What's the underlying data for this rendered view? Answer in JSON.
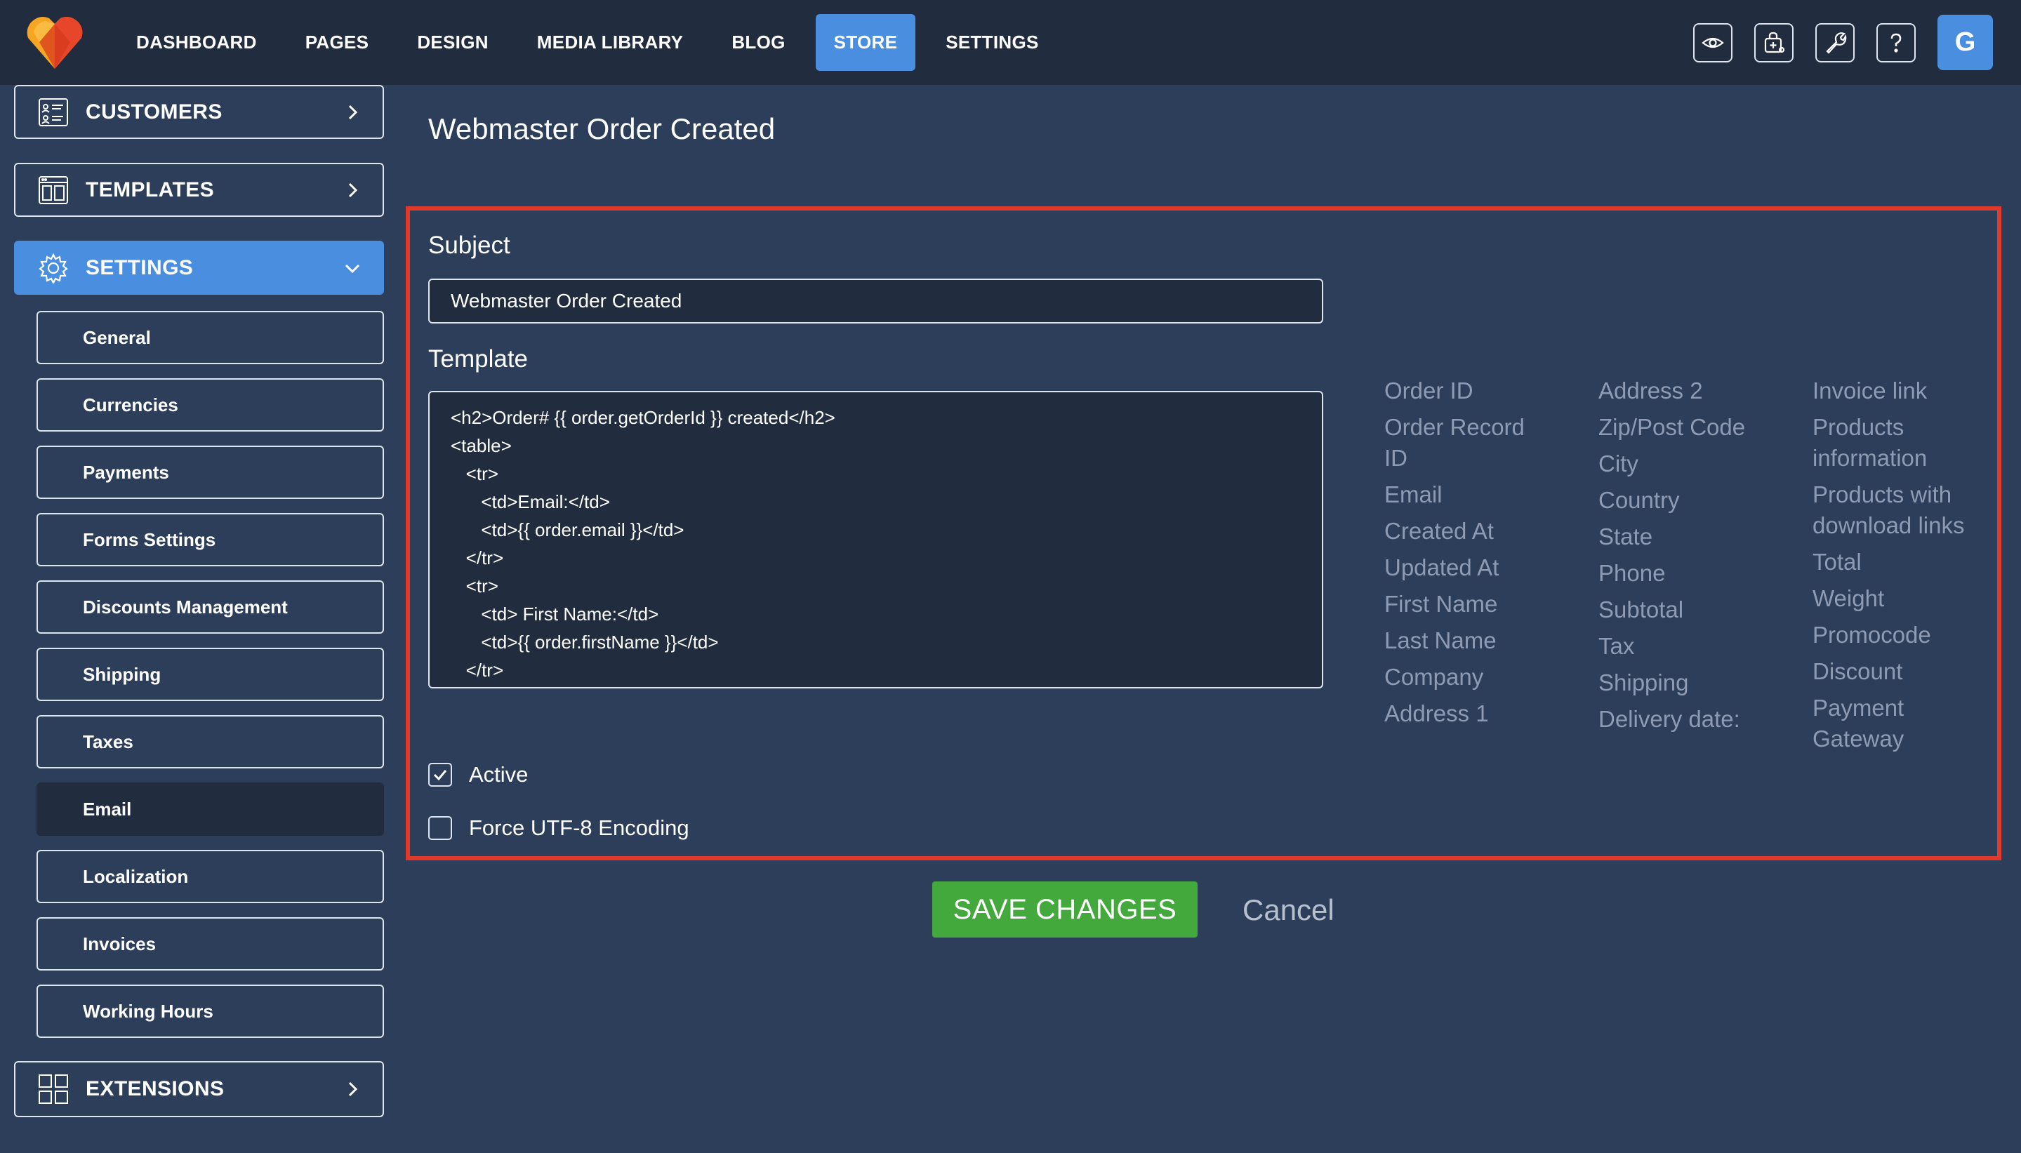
{
  "header": {
    "nav": [
      "DASHBOARD",
      "PAGES",
      "DESIGN",
      "MEDIA LIBRARY",
      "BLOG",
      "STORE",
      "SETTINGS"
    ],
    "active_nav": "STORE",
    "tools": [
      "eye-icon",
      "bag-plus-icon",
      "wrench-icon",
      "question-icon"
    ],
    "avatar_letter": "G",
    "accent_color": "#4a8ee0",
    "logo_colors": [
      "#f6a623",
      "#e8462a"
    ]
  },
  "sidebar": {
    "customers": "CUSTOMERS",
    "templates": "TEMPLATES",
    "settings": "SETTINGS",
    "extensions": "EXTENSIONS",
    "settings_items": [
      "General",
      "Currencies",
      "Payments",
      "Forms Settings",
      "Discounts Management",
      "Shipping",
      "Taxes",
      "Email",
      "Localization",
      "Invoices",
      "Working Hours"
    ],
    "selected_item": "Email"
  },
  "main": {
    "title": "Webmaster Order Created",
    "subject_label": "Subject",
    "subject_value": "Webmaster Order Created",
    "template_label": "Template",
    "template_lines": [
      "<h2>Order# {{ order.getOrderId }} created</h2>",
      "<table>",
      "   <tr>",
      "      <td>Email:</td>",
      "      <td>{{ order.email }}</td>",
      "   </tr>",
      "   <tr>",
      "      <td> First Name:</td>",
      "      <td>{{ order.firstName }}</td>",
      "   </tr>"
    ],
    "variables": {
      "col1": [
        "Order ID",
        "Order Record ID",
        "Email",
        "Created At",
        "Updated At",
        "First Name",
        "Last Name",
        "Company",
        "Address 1"
      ],
      "col2": [
        "Address 2",
        "Zip/Post Code",
        "City",
        "Country",
        "State",
        "Phone",
        "Subtotal",
        "Tax",
        "Shipping",
        "Delivery date:"
      ],
      "col3": [
        "Invoice link",
        "Products information",
        "Products with download links",
        "Total",
        "Weight",
        "Promocode",
        "Discount",
        "Payment Gateway"
      ]
    },
    "active_label": "Active",
    "active_checked": true,
    "utf8_label": "Force UTF-8 Encoding",
    "utf8_checked": false,
    "save_label": "SAVE CHANGES",
    "cancel_label": "Cancel",
    "highlight_color": "#e13a2a",
    "save_color": "#43a93c"
  }
}
